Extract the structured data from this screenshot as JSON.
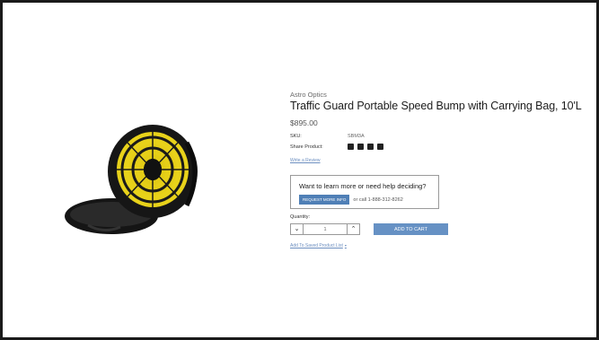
{
  "product": {
    "brand": "Astro Optics",
    "title": "Traffic Guard Portable Speed Bump with Carrying Bag, 10'L",
    "price": "$895.00",
    "sku_label": "SKU:",
    "sku_value": "SBM3A",
    "share_label": "Share Product:",
    "share_icons": [
      "facebook-icon",
      "email-icon",
      "twitter-icon",
      "linkedin-icon"
    ],
    "review_link": "Write a Review"
  },
  "help": {
    "title": "Want to learn more or need help deciding?",
    "request_button": "REQUEST MORE INFO",
    "call_text": "or call 1-888-312-8262"
  },
  "purchase": {
    "quantity_label": "Quantity:",
    "quantity_value": "1",
    "decrement_glyph": "⌄",
    "increment_glyph": "⌃",
    "add_to_cart": "ADD TO CART",
    "saved_list_link": "Add To Saved Product List",
    "saved_list_caret": "▾"
  },
  "colors": {
    "accent": "#4f7fb6",
    "cart_button": "#6691c4",
    "link": "#6d8fc0",
    "bag": "#1b1b1b",
    "speed_bump": "#e8d21a"
  }
}
